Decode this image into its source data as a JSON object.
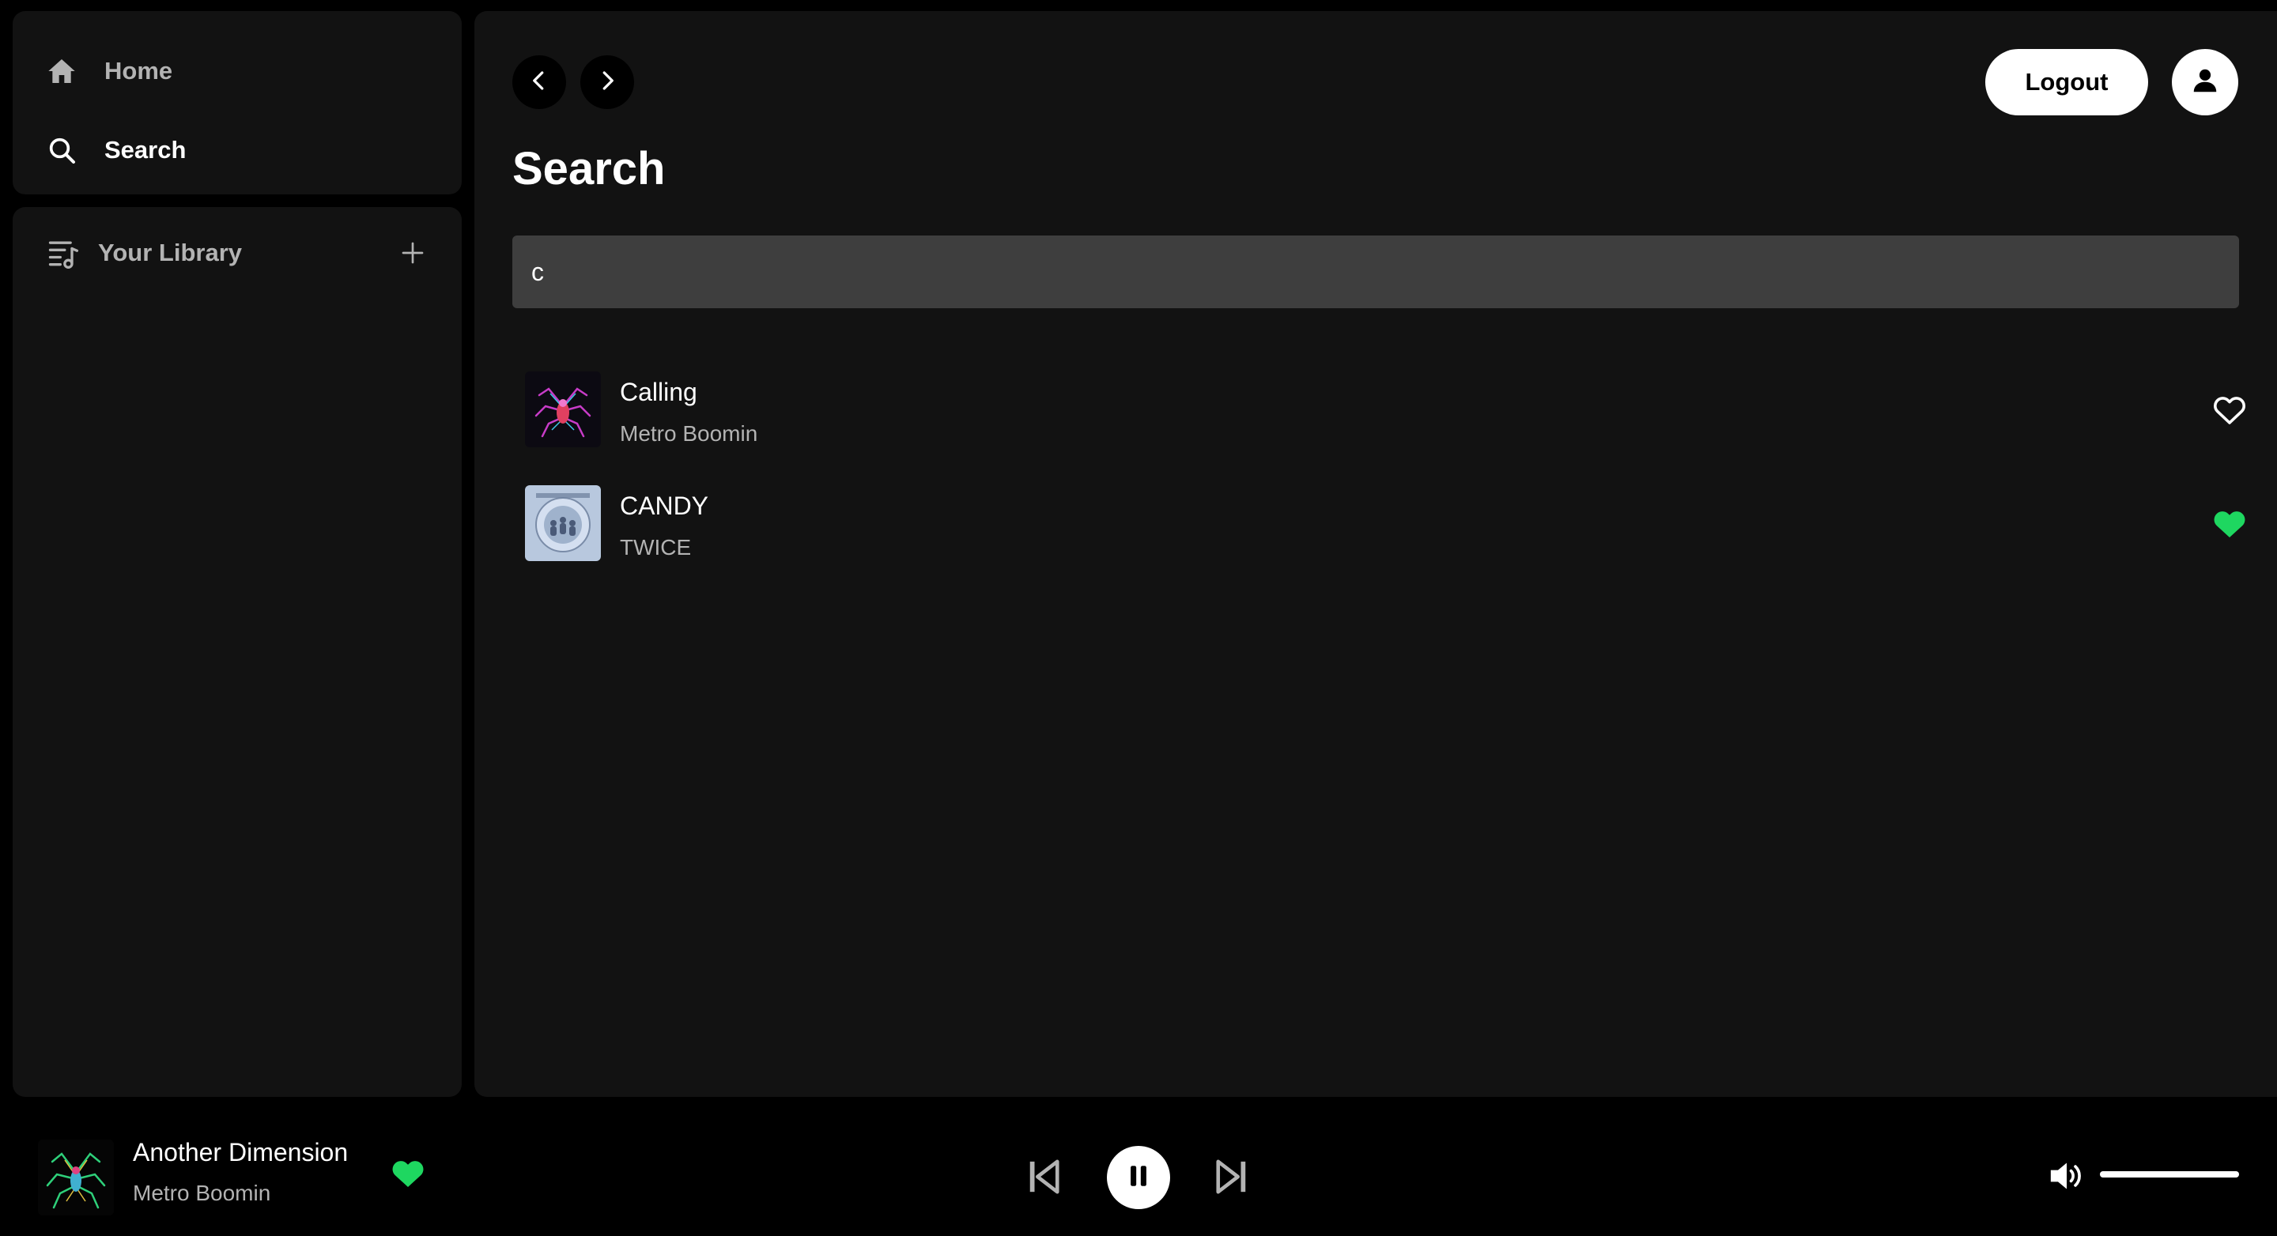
{
  "sidebar": {
    "nav": [
      {
        "label": "Home",
        "icon": "home-icon",
        "active": false
      },
      {
        "label": "Search",
        "icon": "search-icon",
        "active": true
      }
    ],
    "library": {
      "label": "Your Library",
      "icon": "library-icon",
      "add_icon": "plus-icon"
    }
  },
  "header": {
    "back_icon": "chevron-left-icon",
    "forward_icon": "chevron-right-icon",
    "logout_label": "Logout",
    "profile_icon": "user-icon"
  },
  "main": {
    "title": "Search",
    "search_value": "c",
    "results": [
      {
        "title": "Calling",
        "artist": "Metro Boomin",
        "liked": false
      },
      {
        "title": "CANDY",
        "artist": "TWICE",
        "liked": true
      }
    ]
  },
  "player": {
    "title": "Another Dimension",
    "artist": "Metro Boomin",
    "liked": true,
    "state": "playing",
    "volume": 1.0
  },
  "colors": {
    "accent": "#1ed760",
    "panel": "#121212",
    "background": "#000000",
    "input": "#3e3e3e",
    "muted_text": "#b3b3b3"
  }
}
